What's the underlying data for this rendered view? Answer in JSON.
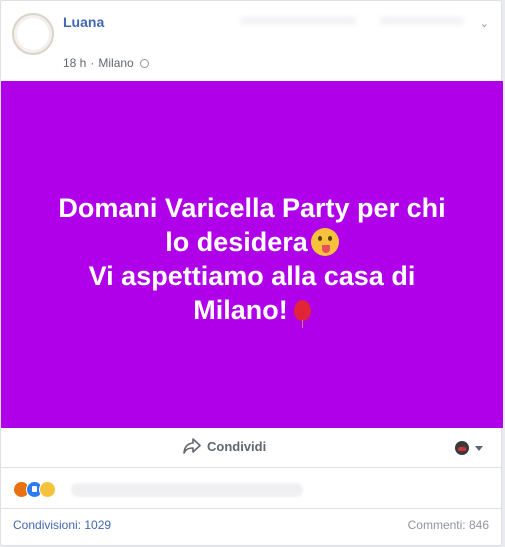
{
  "header": {
    "author": "Luana",
    "time": "18 h",
    "separator": "·",
    "location": "Milano",
    "options_chevron": "⌄"
  },
  "banner": {
    "line1": "Domani Varicella Party per chi",
    "line2": "lo desidera",
    "line3": "Vi aspettiamo alla casa di",
    "line4": "Milano!",
    "background_color": "#b000ea"
  },
  "actions": {
    "share_label": "Condividi"
  },
  "reactions": [
    "angry",
    "like",
    "haha"
  ],
  "footer": {
    "shares": "Condivisioni: 1029",
    "comments": "Commenti: 846"
  }
}
